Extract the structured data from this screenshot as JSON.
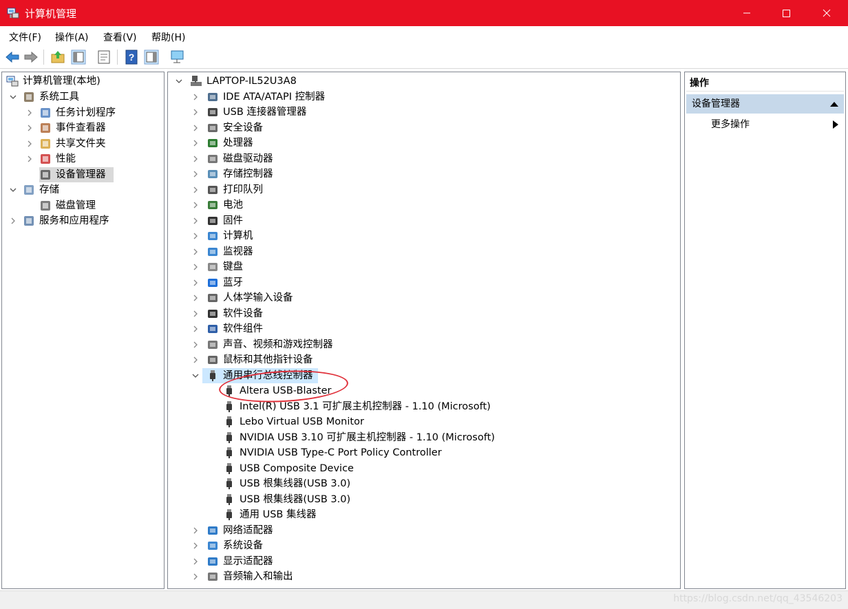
{
  "window": {
    "title": "计算机管理",
    "accent": "#e81123",
    "controls": [
      "minimize",
      "maximize",
      "close"
    ]
  },
  "menu": [
    "文件(F)",
    "操作(A)",
    "查看(V)",
    "帮助(H)"
  ],
  "toolbar": [
    "back-icon",
    "forward-icon",
    "up-folder-icon",
    "show-hide-tree-icon",
    "properties-icon",
    "help-icon",
    "action-pane-icon",
    "monitor-icon"
  ],
  "left_tree": {
    "root": "计算机管理(本地)",
    "items": [
      {
        "label": "系统工具",
        "icon": "tools-icon"
      },
      {
        "label": "任务计划程序",
        "icon": "clock-icon"
      },
      {
        "label": "事件查看器",
        "icon": "event-viewer-icon"
      },
      {
        "label": "共享文件夹",
        "icon": "shared-folder-icon"
      },
      {
        "label": "性能",
        "icon": "performance-icon"
      },
      {
        "label": "设备管理器",
        "icon": "device-manager-icon"
      },
      {
        "label": "存储",
        "icon": "storage-icon"
      },
      {
        "label": "磁盘管理",
        "icon": "disk-management-icon"
      },
      {
        "label": "服务和应用程序",
        "icon": "services-icon"
      }
    ]
  },
  "device_tree": {
    "root": "LAPTOP-IL52U3A8",
    "categories": [
      "IDE ATA/ATAPI 控制器",
      "USB 连接器管理器",
      "安全设备",
      "处理器",
      "磁盘驱动器",
      "存储控制器",
      "打印队列",
      "电池",
      "固件",
      "计算机",
      "监视器",
      "键盘",
      "蓝牙",
      "人体学输入设备",
      "软件设备",
      "软件组件",
      "声音、视频和游戏控制器",
      "鼠标和其他指针设备",
      "通用串行总线控制器"
    ],
    "usb_children": [
      "Altera USB-Blaster",
      "Intel(R) USB 3.1 可扩展主机控制器 - 1.10 (Microsoft)",
      "Lebo Virtual USB Monitor",
      "NVIDIA USB 3.10 可扩展主机控制器 - 1.10 (Microsoft)",
      "NVIDIA USB Type-C Port Policy Controller",
      "USB Composite Device",
      "USB 根集线器(USB 3.0)",
      "USB 根集线器(USB 3.0)",
      "通用 USB 集线器"
    ],
    "after": [
      "网络适配器",
      "系统设备",
      "显示适配器",
      "音频输入和输出"
    ]
  },
  "actions": {
    "header": "操作",
    "section": "设备管理器",
    "more": "更多操作"
  },
  "watermark": "https://blog.csdn.net/qq_43546203"
}
